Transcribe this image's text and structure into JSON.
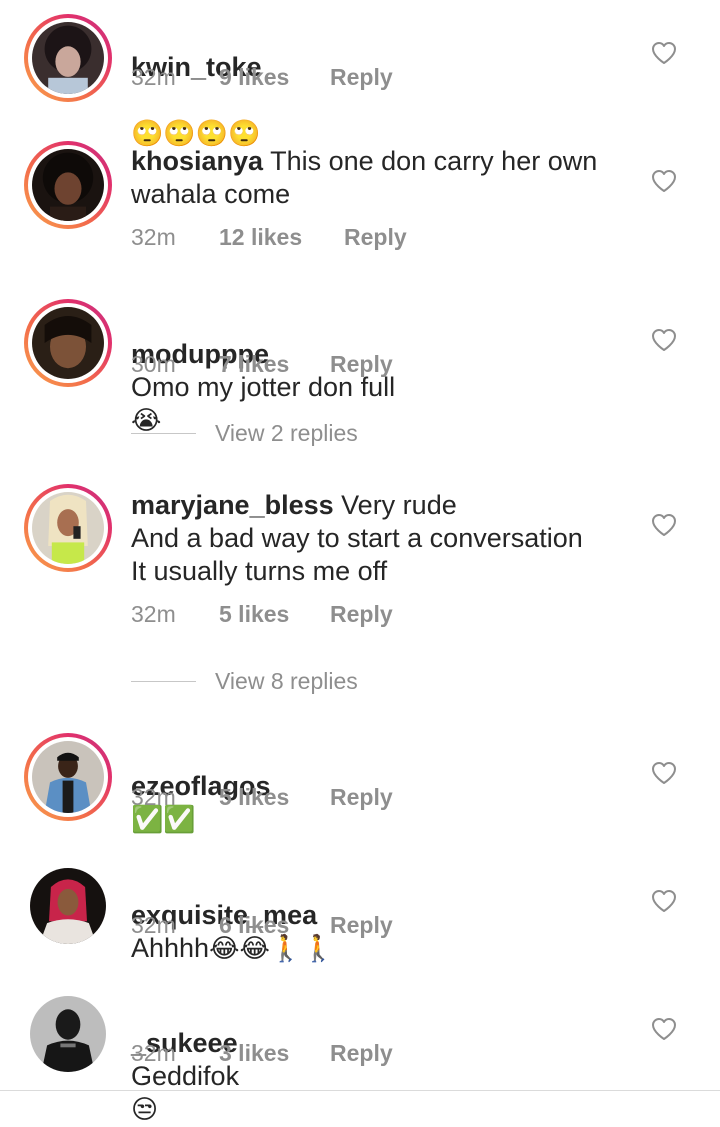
{
  "comments": [
    {
      "username": "kwin_toke",
      "text": "",
      "emoji": "🙄🙄🙄🙄",
      "time": "32m",
      "likes": "9 likes",
      "reply": "Reply"
    },
    {
      "username": "khosianya",
      "text": "This one don carry her own\nwahala come",
      "emoji": "",
      "time": "32m",
      "likes": "12 likes",
      "reply": "Reply"
    },
    {
      "username": "modupppe",
      "text": "Omo my jotter don full",
      "emoji": "😭",
      "time": "30m",
      "likes": "7 likes",
      "reply": "Reply",
      "view_replies": "View 2 replies"
    },
    {
      "username": "maryjane_bless",
      "text": "Very rude\nAnd a bad way to start a conversation\nIt usually turns me off",
      "emoji": "",
      "time": "32m",
      "likes": "5 likes",
      "reply": "Reply",
      "view_replies": "View 8 replies"
    },
    {
      "username": "ezeoflagos",
      "text": "",
      "emoji": "✅✅",
      "time": "32m",
      "likes": "5 likes",
      "reply": "Reply"
    },
    {
      "username": "exquisite_mea",
      "text": "Ahhhh",
      "emoji": "😂😂🚶🚶",
      "time": "32m",
      "likes": "6 likes",
      "reply": "Reply"
    },
    {
      "username": "_sukeee",
      "text": "Geddifok",
      "emoji": "😒",
      "time": "32m",
      "likes": "3 likes",
      "reply": "Reply"
    }
  ],
  "icons": {
    "like": "heart-outline-icon"
  },
  "colors": {
    "text": "#262626",
    "secondary": "#8e8e8e",
    "story_ring_start": "#f9a24c",
    "story_ring_end": "#c13584"
  }
}
